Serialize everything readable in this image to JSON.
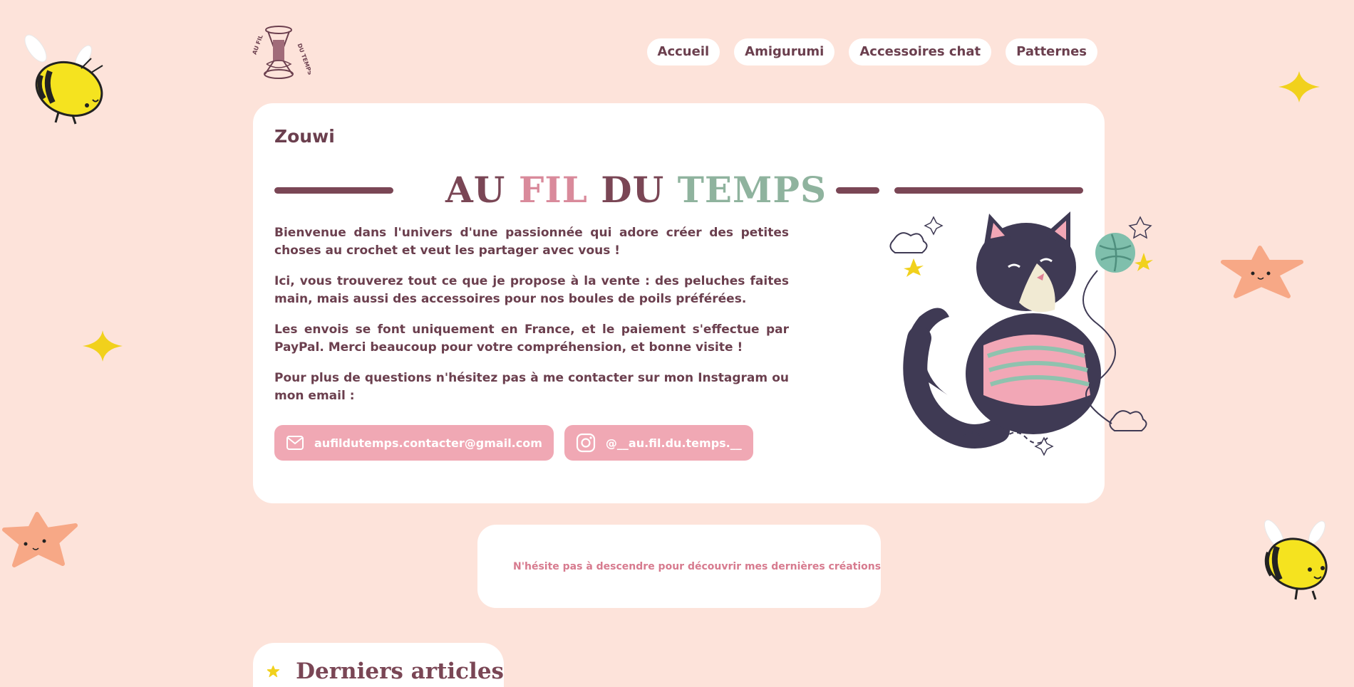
{
  "logo": {
    "left_text": "AU FIL",
    "right_text": "DU TEMPS"
  },
  "nav": {
    "items": [
      {
        "label": "Accueil"
      },
      {
        "label": "Amigurumi"
      },
      {
        "label": "Accessoires chat"
      },
      {
        "label": "Patternes"
      }
    ]
  },
  "card": {
    "author": "Zouwi",
    "title": {
      "part1": "AU",
      "part2": "FIL",
      "part3": "DU",
      "part4": "TEMPS"
    },
    "paragraphs": [
      "Bienvenue dans l'univers d'une passionnée qui adore créer des petites choses au crochet et veut les partager avec vous !",
      "Ici, vous trouverez tout ce que je propose à la vente : des peluches faites main, mais aussi des accessoires pour nos boules de poils préférées.",
      "Les envois se font uniquement en France, et le paiement s'effectue par PayPal. Merci beaucoup pour votre compréhension, et bonne visite !",
      "Pour plus de questions n'hésitez pas à me contacter sur mon Instagram ou mon email :"
    ],
    "email": "aufildutemps.contacter@gmail.com",
    "instagram": "@__au.fil.du.temps.__"
  },
  "hint": {
    "text": "N'hésite pas à descendre pour découvrir mes dernières créations"
  },
  "section": {
    "title": "Derniers articles"
  },
  "colors": {
    "background": "#fde3da",
    "primary": "#6b3f4e",
    "pink": "#d98a9b",
    "green": "#8fb39e",
    "button_pink": "#f0a8b4",
    "star_yellow": "#f1d11c",
    "star_peach": "#f7a886"
  }
}
